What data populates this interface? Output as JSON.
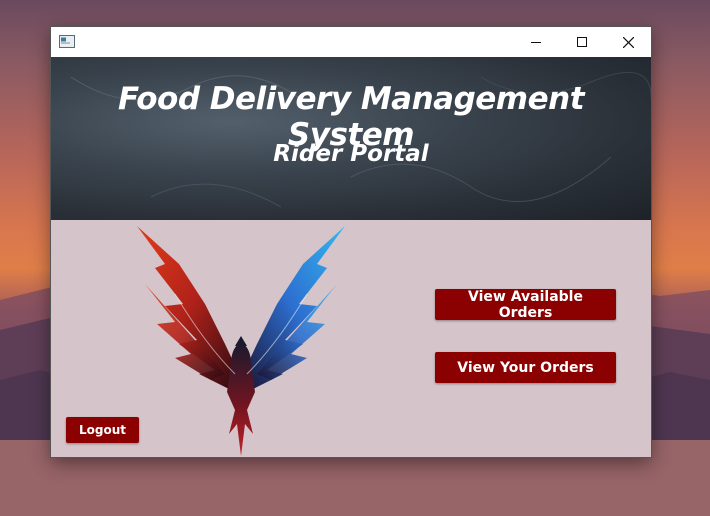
{
  "window": {
    "title_icon": "app-window-icon",
    "controls": [
      "minimize-icon",
      "maximize-icon",
      "close-icon"
    ]
  },
  "banner": {
    "title": "Food Delivery Management System",
    "subtitle": "Rider Portal"
  },
  "actions": {
    "view_available": "View Available Orders",
    "view_yours": "View Your Orders",
    "logout": "Logout"
  },
  "logo": {
    "icon": "phoenix-bird-logo"
  },
  "colors": {
    "button": "#8b0000",
    "content_bg": "#d5c4c9",
    "banner_bg": "#2f363e",
    "button_text": "#ffffff"
  }
}
